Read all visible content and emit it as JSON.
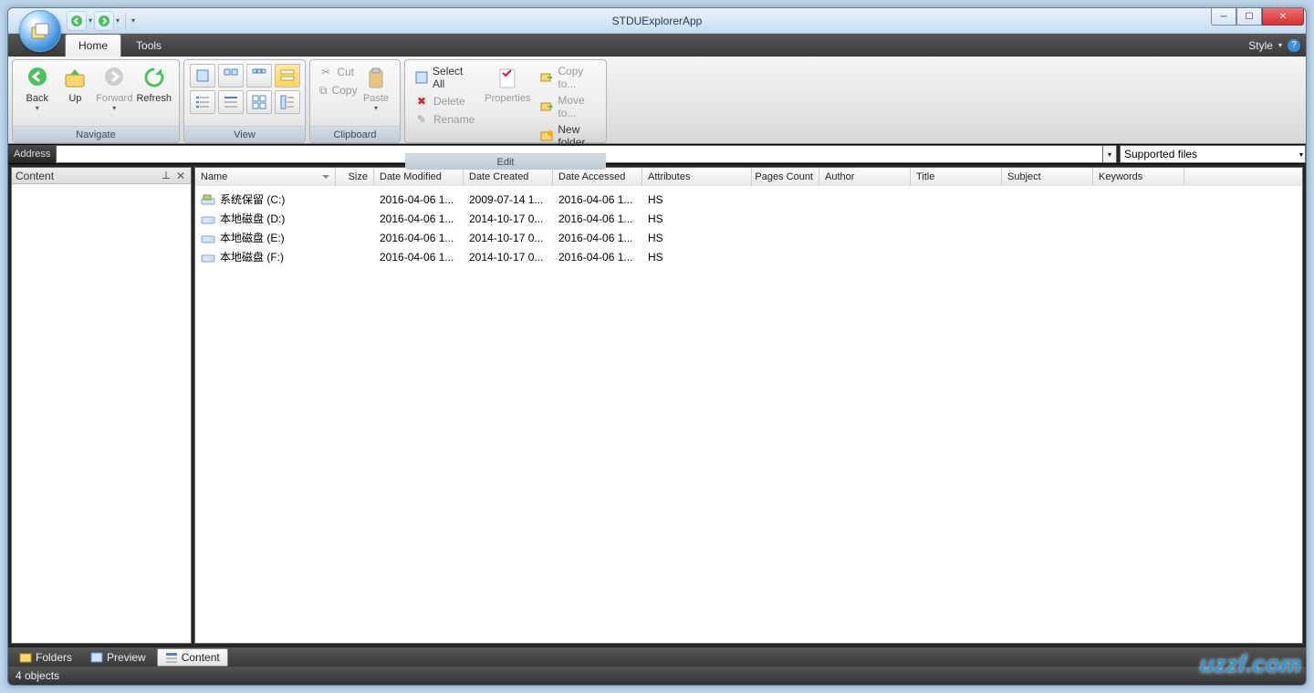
{
  "app_title": "STDUExplorerApp",
  "tabs": {
    "home": "Home",
    "tools": "Tools"
  },
  "style_menu": {
    "label": "Style"
  },
  "ribbon": {
    "navigate": {
      "label": "Navigate",
      "back": "Back",
      "up": "Up",
      "forward": "Forward",
      "refresh": "Refresh"
    },
    "view": {
      "label": "View"
    },
    "clipboard": {
      "label": "Clipboard",
      "cut": "Cut",
      "copy": "Copy",
      "paste": "Paste"
    },
    "edit": {
      "label": "Edit",
      "select_all": "Select All",
      "delete": "Delete",
      "rename": "Rename",
      "properties": "Properties",
      "copy_to": "Copy to...",
      "move_to": "Move to...",
      "new_folder": "New folder"
    }
  },
  "address": {
    "label": "Address",
    "value": ""
  },
  "filter": {
    "value": "Supported files"
  },
  "side_panel": {
    "title": "Content"
  },
  "columns": {
    "name": "Name",
    "size": "Size",
    "modified": "Date Modified",
    "created": "Date Created",
    "accessed": "Date Accessed",
    "attributes": "Attributes",
    "pages": "Pages Count",
    "author": "Author",
    "title": "Title",
    "subject": "Subject",
    "keywords": "Keywords"
  },
  "rows": [
    {
      "icon": "system",
      "name": "系统保留 (C:)",
      "size": "",
      "modified": "2016-04-06 1...",
      "created": "2009-07-14 1...",
      "accessed": "2016-04-06 1...",
      "attributes": "HS"
    },
    {
      "icon": "hdd",
      "name": "本地磁盘 (D:)",
      "size": "",
      "modified": "2016-04-06 1...",
      "created": "2014-10-17 0...",
      "accessed": "2016-04-06 1...",
      "attributes": "HS"
    },
    {
      "icon": "hdd",
      "name": "本地磁盘 (E:)",
      "size": "",
      "modified": "2016-04-06 1...",
      "created": "2014-10-17 0...",
      "accessed": "2016-04-06 1...",
      "attributes": "HS"
    },
    {
      "icon": "hdd",
      "name": "本地磁盘 (F:)",
      "size": "",
      "modified": "2016-04-06 1...",
      "created": "2014-10-17 0...",
      "accessed": "2016-04-06 1...",
      "attributes": "HS"
    }
  ],
  "bottom_tabs": {
    "folders": "Folders",
    "preview": "Preview",
    "content": "Content"
  },
  "status": {
    "text": "4 objects"
  },
  "watermark": "uzzf.com"
}
